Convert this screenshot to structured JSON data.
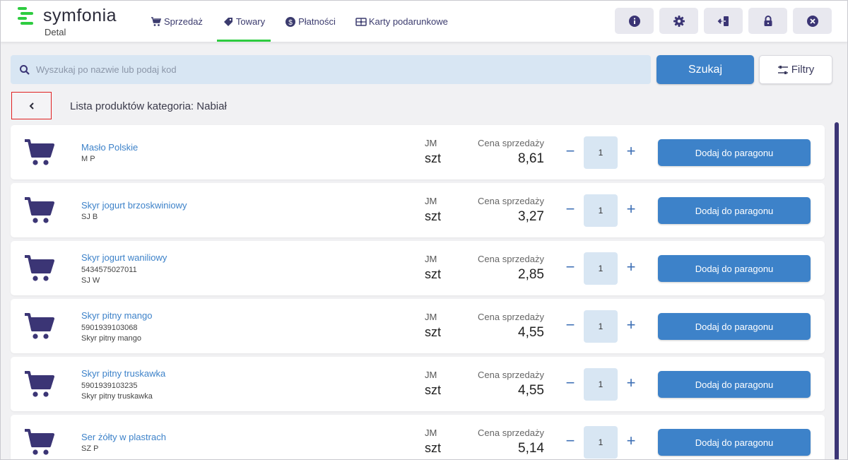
{
  "app": {
    "logo_name": "symfonia",
    "logo_sub": "Detal",
    "accent": "#2ecc40",
    "primary": "#3d82c9",
    "icon_color": "#3b3575"
  },
  "nav": {
    "tabs": [
      {
        "label": "Sprzedaż",
        "icon": "cart-icon"
      },
      {
        "label": "Towary",
        "icon": "tag-icon",
        "active": true
      },
      {
        "label": "Płatności",
        "icon": "dollar-icon"
      },
      {
        "label": "Karty podarunkowe",
        "icon": "gift-card-icon"
      }
    ]
  },
  "toolbar": {
    "buttons": [
      "info-icon",
      "gear-icon",
      "logout-icon",
      "lock-icon",
      "close-icon"
    ]
  },
  "search": {
    "placeholder": "Wyszukaj po nazwie lub podaj kod",
    "value": "",
    "button_label": "Szukaj",
    "filters_label": "Filtry"
  },
  "list": {
    "title": "Lista produktów kategoria: Nabiał",
    "jm_label": "JM",
    "price_label": "Cena sprzedaży",
    "add_label": "Dodaj do paragonu",
    "products": [
      {
        "name": "Masło Polskie",
        "lines": [
          "M P"
        ],
        "unit": "szt",
        "price": "8,61",
        "qty": "1"
      },
      {
        "name": "Skyr jogurt brzoskwiniowy",
        "lines": [
          "SJ B"
        ],
        "unit": "szt",
        "price": "3,27",
        "qty": "1"
      },
      {
        "name": "Skyr jogurt waniliowy",
        "lines": [
          "5434575027011",
          "SJ W"
        ],
        "unit": "szt",
        "price": "2,85",
        "qty": "1"
      },
      {
        "name": "Skyr pitny mango",
        "lines": [
          "5901939103068",
          "Skyr pitny mango"
        ],
        "unit": "szt",
        "price": "4,55",
        "qty": "1"
      },
      {
        "name": "Skyr pitny truskawka",
        "lines": [
          "5901939103235",
          "Skyr pitny truskawka"
        ],
        "unit": "szt",
        "price": "4,55",
        "qty": "1"
      },
      {
        "name": "Ser żółty w plastrach",
        "lines": [
          "SZ P"
        ],
        "unit": "szt",
        "price": "5,14",
        "qty": "1"
      }
    ]
  }
}
